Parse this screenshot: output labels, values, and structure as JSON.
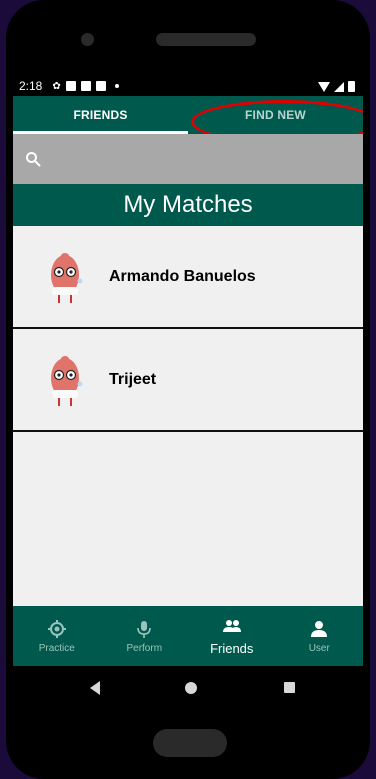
{
  "status": {
    "time": "2:18"
  },
  "tabs": [
    {
      "label": "FRIENDS",
      "active": true
    },
    {
      "label": "FIND NEW",
      "active": false
    }
  ],
  "search": {
    "icon": "search-icon"
  },
  "header": {
    "title": "My Matches"
  },
  "matches": [
    {
      "name": "Armando Banuelos",
      "avatar": "mascot-avatar"
    },
    {
      "name": "Trijeet",
      "avatar": "mascot-avatar"
    }
  ],
  "nav": [
    {
      "label": "Practice",
      "icon": "target-icon"
    },
    {
      "label": "Perform",
      "icon": "microphone-icon"
    },
    {
      "label": "Friends",
      "icon": "people-icon",
      "active": true
    },
    {
      "label": "User",
      "icon": "person-icon"
    }
  ],
  "colors": {
    "primary": "#00594d",
    "highlight_ring": "#e00000",
    "search_bg": "#a8a8a8",
    "list_bg": "#f0f0f0"
  }
}
